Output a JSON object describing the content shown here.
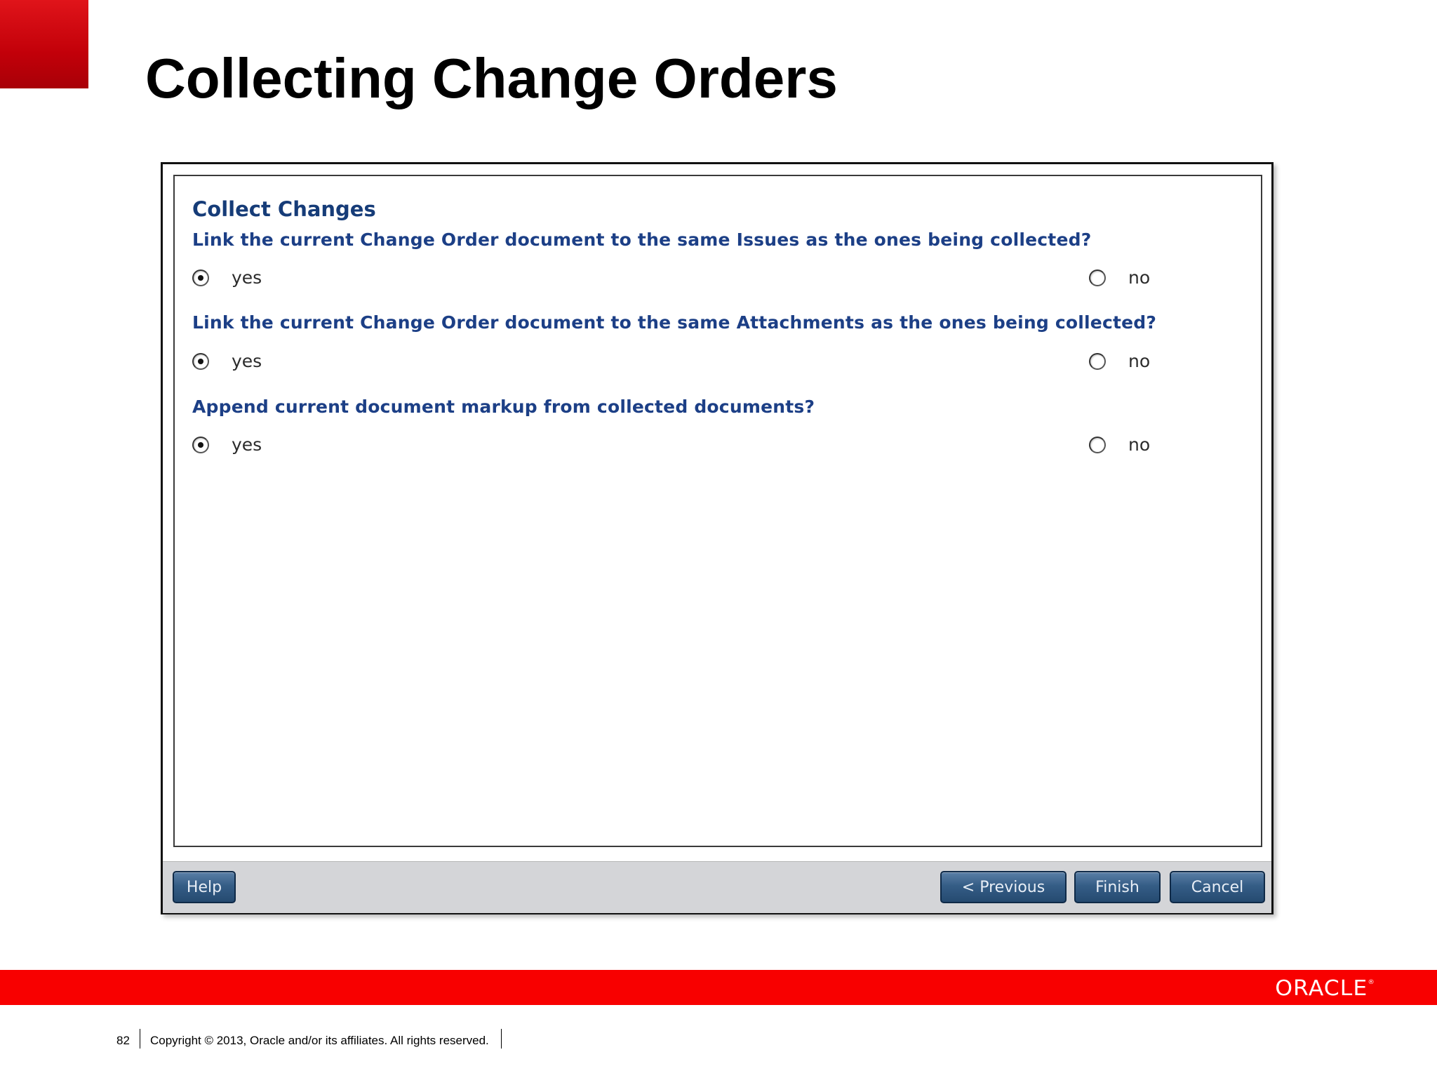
{
  "slide": {
    "title": "Collecting Change Orders",
    "page_number": "82",
    "copyright": "Copyright © 2013, Oracle and/or its affiliates. All rights reserved.",
    "brand": {
      "logo_text": "ORACLE",
      "logo_mark": "®",
      "bar_color": "#f80000",
      "accent_color": "#c20009"
    }
  },
  "dialog": {
    "heading": "Collect Changes",
    "questions": [
      {
        "text": "Link the current Change Order document to the same Issues as the ones being collected?",
        "options": [
          {
            "label": "yes",
            "selected": true
          },
          {
            "label": "no",
            "selected": false
          }
        ]
      },
      {
        "text": "Link the current Change Order document to the same Attachments as the ones being collected?",
        "options": [
          {
            "label": "yes",
            "selected": true
          },
          {
            "label": "no",
            "selected": false
          }
        ]
      },
      {
        "text": "Append current document markup from collected documents?",
        "options": [
          {
            "label": "yes",
            "selected": true
          },
          {
            "label": "no",
            "selected": false
          }
        ]
      }
    ],
    "buttons": {
      "help": "Help",
      "previous": "< Previous",
      "finish": "Finish",
      "cancel": "Cancel"
    }
  }
}
